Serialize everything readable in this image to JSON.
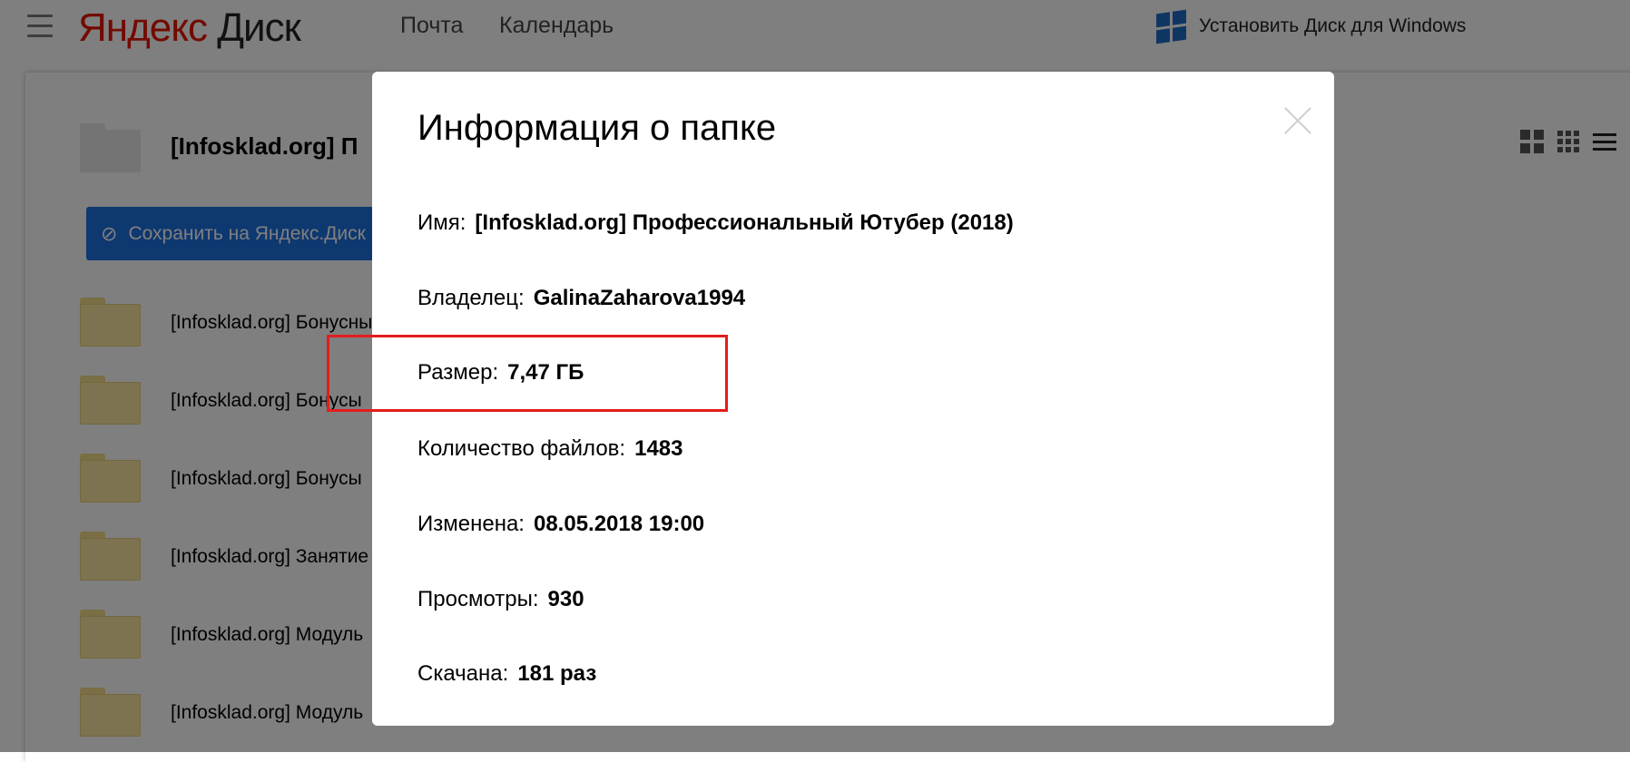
{
  "header": {
    "logo_yandex": "Яндекс",
    "logo_disk": "Диск",
    "nav": [
      "Почта",
      "Календарь"
    ],
    "install_label": "Установить Диск для Windows"
  },
  "folder": {
    "title": "[Infosklad.org] П",
    "save_label": "Сохранить на Яндекс.Диск",
    "items": [
      "[Infosklad.org] Бонусны",
      "[Infosklad.org] Бонусы",
      "[Infosklad.org] Бонусы",
      "[Infosklad.org] Занятие",
      "[Infosklad.org] Модуль",
      "[Infosklad.org] Модуль"
    ]
  },
  "modal": {
    "title": "Информация о папке",
    "rows": [
      {
        "label": "Имя:",
        "value": "[Infosklad.org] Профессиональный Ютубер (2018)"
      },
      {
        "label": "Владелец:",
        "value": "GalinaZaharova1994"
      },
      {
        "label": "Размер:",
        "value": "7,47 ГБ"
      },
      {
        "label": "Количество файлов:",
        "value": "1483"
      },
      {
        "label": "Изменена:",
        "value": "08.05.2018 19:00"
      },
      {
        "label": "Просмотры:",
        "value": "930"
      },
      {
        "label": "Скачана:",
        "value": "181 раз"
      }
    ]
  },
  "colors": {
    "accent": "#1c70e0",
    "logo_red": "#e61400",
    "highlight": "#e41c1c"
  },
  "icons": [
    "menu-icon",
    "windows-icon",
    "disk-icon",
    "close-icon",
    "tiles-large-icon",
    "tiles-small-icon",
    "list-icon",
    "folder-icon"
  ]
}
